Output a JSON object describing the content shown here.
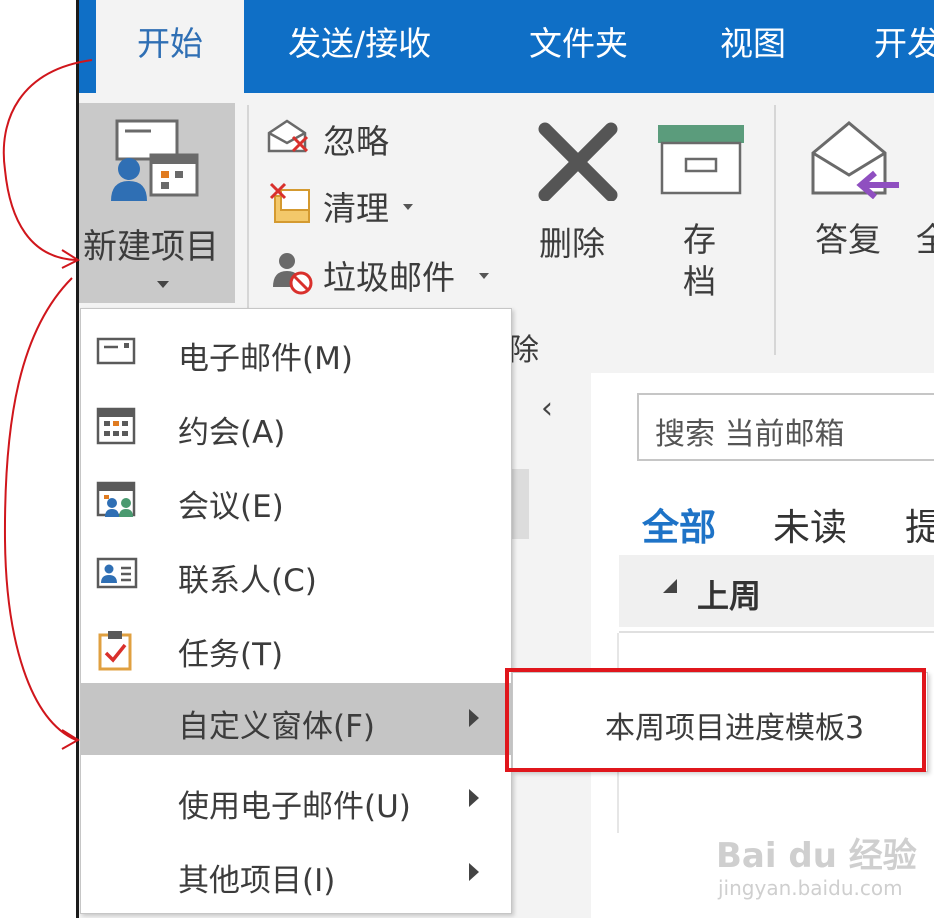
{
  "tabs": [
    {
      "label": "开始",
      "active": true
    },
    {
      "label": "发送/接收",
      "active": false
    },
    {
      "label": "文件夹",
      "active": false
    },
    {
      "label": "视图",
      "active": false
    },
    {
      "label": "开发",
      "active": false
    }
  ],
  "ribbon": {
    "new_item_label": "新建项目",
    "ignore_label": "忽略",
    "cleanup_label": "清理",
    "junk_label": "垃圾邮件",
    "delete_label": "删除",
    "archive_label_1": "存",
    "archive_label_2": "档",
    "reply_label": "答复",
    "reply_all_partial": "全",
    "group_delete_partial": "除"
  },
  "menu": {
    "items": [
      {
        "label": "电子邮件(M)",
        "icon": "email-icon"
      },
      {
        "label": "约会(A)",
        "icon": "calendar-icon"
      },
      {
        "label": "会议(E)",
        "icon": "meeting-icon"
      },
      {
        "label": "联系人(C)",
        "icon": "contact-card-icon"
      },
      {
        "label": "任务(T)",
        "icon": "task-clipboard-icon"
      },
      {
        "label": "自定义窗体(F)",
        "has_submenu": true,
        "highlighted": true
      },
      {
        "label": "使用电子邮件(U)",
        "has_submenu": true
      },
      {
        "label": "其他项目(I)",
        "has_submenu": true
      }
    ]
  },
  "submenu": {
    "items": [
      {
        "label": "本周项目进度模板3"
      }
    ]
  },
  "content": {
    "search_placeholder": "搜索 当前邮箱",
    "filter_all": "全部",
    "filter_unread": "未读",
    "filter_partial": "提",
    "group_header": "上周"
  },
  "watermark": {
    "brand": "Bai du 经验",
    "url": "jingyan.baidu.com"
  },
  "colors": {
    "accent": "#0f6fc6",
    "highlight_box": "#e0161c",
    "annotation_arrow": "#d0161c"
  }
}
